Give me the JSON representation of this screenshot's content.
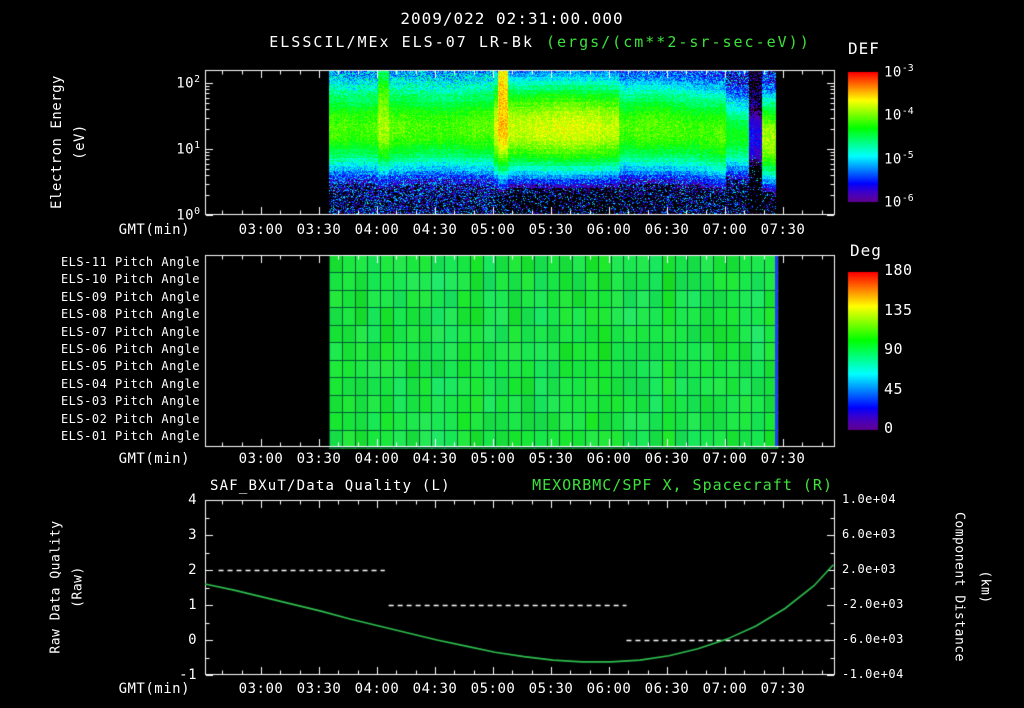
{
  "header": {
    "title": "2009/022 02:31:00.000"
  },
  "colors": {
    "background": "#000000",
    "text": "#ffffff",
    "accent_green": "#3ce13c",
    "curve_green": "#2ebf4f"
  },
  "panel1": {
    "title": "ELSSCIL/MEx ELS-07 LR-Bk",
    "units": "(ergs/(cm**2-sr-sec-eV))",
    "ylabel_line1": "Electron Energy",
    "ylabel_line2": "(eV)",
    "yticks": [
      {
        "base": "10",
        "exp": "2"
      },
      {
        "base": "10",
        "exp": "1"
      },
      {
        "base": "10",
        "exp": "0"
      }
    ],
    "colorbar_title": "DEF",
    "colorbar_ticks": [
      {
        "base": "10",
        "exp": "-3"
      },
      {
        "base": "10",
        "exp": "-4"
      },
      {
        "base": "10",
        "exp": "-5"
      },
      {
        "base": "10",
        "exp": "-6"
      }
    ],
    "xlabel": "GMT(min)"
  },
  "panel2": {
    "row_labels": [
      "ELS-11 Pitch Angle",
      "ELS-10 Pitch Angle",
      "ELS-09 Pitch Angle",
      "ELS-08 Pitch Angle",
      "ELS-07 Pitch Angle",
      "ELS-06 Pitch Angle",
      "ELS-05 Pitch Angle",
      "ELS-04 Pitch Angle",
      "ELS-03 Pitch Angle",
      "ELS-02 Pitch Angle",
      "ELS-01 Pitch Angle"
    ],
    "colorbar_title": "Deg",
    "colorbar_ticks": [
      "180",
      "135",
      "90",
      "45",
      "0"
    ],
    "xlabel": "GMT(min)"
  },
  "panel3": {
    "title_left": "SAF_BXuT/Data Quality (L)",
    "title_right": "MEXORBMC/SPF X, Spacecraft (R)",
    "ylabel_left_line1": "Raw Data Quality",
    "ylabel_left_line2": "(Raw)",
    "ylabel_right_line1": "Component Distance",
    "ylabel_right_line2": "(km)",
    "yticks_left": [
      "4",
      "3",
      "2",
      "1",
      "0",
      "-1"
    ],
    "yticks_right": [
      "1.0e+04",
      "6.0e+03",
      "2.0e+03",
      "-2.0e+03",
      "-6.0e+03",
      "-1.0e+04"
    ],
    "xlabel": "GMT(min)"
  },
  "xticks": [
    "03:00",
    "03:30",
    "04:00",
    "04:30",
    "05:00",
    "05:30",
    "06:00",
    "06:30",
    "07:00",
    "07:30"
  ],
  "time_axis": {
    "start_gmt": "02:31",
    "end_gmt": "07:56"
  },
  "chart_data": [
    {
      "type": "heatmap",
      "name": "electron-energy-spectrogram",
      "title": "ELSSCIL/MEx ELS-07 LR-Bk (ergs/(cm**2-sr-sec-eV))",
      "xlabel": "GMT(min)",
      "ylabel": "Electron Energy (eV)",
      "x_ticks": [
        "03:00",
        "03:30",
        "04:00",
        "04:30",
        "05:00",
        "05:30",
        "06:00",
        "06:30",
        "07:00",
        "07:30"
      ],
      "x_range_gmt": [
        "02:31",
        "07:56"
      ],
      "y_scale": "log",
      "y_range_ev": [
        1,
        158
      ],
      "colorbar_title": "DEF",
      "flux_range": [
        1e-06,
        0.001
      ],
      "data_window_gmt": [
        "03:35",
        "07:26"
      ],
      "band": {
        "center_ev": 21,
        "sigma_decades_low": 0.28,
        "sigma_decades_high": 0.3,
        "peak_flux": 8e-05
      },
      "features": [
        {
          "gmt": "04:03",
          "kind": "enhancement",
          "amp": 1.7,
          "sigma_high": 0.45,
          "half_width_min": 3
        },
        {
          "gmt_range": [
            "05:00",
            "06:05"
          ],
          "kind": "brightening",
          "amp": 2.2
        },
        {
          "gmt": "05:05",
          "kind": "spike",
          "amp": 4.0,
          "sigma_high": 1.0,
          "half_width_min": 2.5
        },
        {
          "gmt_range": [
            "07:00",
            "07:12"
          ],
          "kind": "fading",
          "amp": 0.55
        },
        {
          "gmt_range": [
            "07:12",
            "07:19"
          ],
          "kind": "dropout",
          "amp": 0.03
        },
        {
          "gmt_range": [
            "07:19",
            "07:26"
          ],
          "kind": "edge_burst",
          "amp": 1.8
        }
      ],
      "background_speckle": {
        "above_band_logflux_mean": -5.25,
        "below_band_logflux_mean": -5.7
      }
    },
    {
      "type": "heatmap",
      "name": "pitch-angle-panels",
      "rows": [
        "ELS-11 Pitch Angle",
        "ELS-10 Pitch Angle",
        "ELS-09 Pitch Angle",
        "ELS-08 Pitch Angle",
        "ELS-07 Pitch Angle",
        "ELS-06 Pitch Angle",
        "ELS-05 Pitch Angle",
        "ELS-04 Pitch Angle",
        "ELS-03 Pitch Angle",
        "ELS-02 Pitch Angle",
        "ELS-01 Pitch Angle"
      ],
      "colorbar_title": "Deg",
      "value_range_deg": [
        0,
        180
      ],
      "data_window_gmt": [
        "03:35",
        "07:27"
      ],
      "uniform_value_deg": 95,
      "grid_cols": 35,
      "right_edge_value_deg": 30
    },
    {
      "type": "line",
      "name": "data-quality-and-spacecraft-x",
      "xlabel": "GMT(min)",
      "x_ticks": [
        "03:00",
        "03:30",
        "04:00",
        "04:30",
        "05:00",
        "05:30",
        "06:00",
        "06:30",
        "07:00",
        "07:30"
      ],
      "left_axis": {
        "label": "Raw Data Quality (Raw)",
        "range": [
          -1,
          4
        ]
      },
      "right_axis": {
        "label": "Component Distance (km)",
        "range": [
          -10000,
          10000
        ]
      },
      "series": [
        {
          "name": "SAF_BXuT/Data Quality (L)",
          "axis": "left",
          "style": "dashed",
          "color": "#ffffff",
          "segments": [
            {
              "gmt": [
                "02:38",
                "04:04"
              ],
              "value": 2
            },
            {
              "gmt": [
                "04:06",
                "06:09"
              ],
              "value": 1
            },
            {
              "gmt": [
                "06:09",
                "07:54"
              ],
              "value": 0
            }
          ]
        },
        {
          "name": "MEXORBMC/SPF X, Spacecraft (R)",
          "axis": "right",
          "style": "solid",
          "color": "#2ebf4f",
          "x_minutes_after_start": [
            0,
            15,
            30,
            45,
            60,
            75,
            90,
            105,
            120,
            135,
            150,
            165,
            180,
            195,
            210,
            225,
            240,
            255,
            270,
            285,
            300,
            315,
            325
          ],
          "values_km": [
            400,
            -300,
            -1100,
            -1900,
            -2700,
            -3600,
            -4400,
            -5200,
            -6000,
            -6700,
            -7400,
            -7900,
            -8300,
            -8500,
            -8500,
            -8300,
            -7800,
            -7000,
            -5900,
            -4400,
            -2400,
            200,
            2600
          ]
        }
      ]
    }
  ]
}
